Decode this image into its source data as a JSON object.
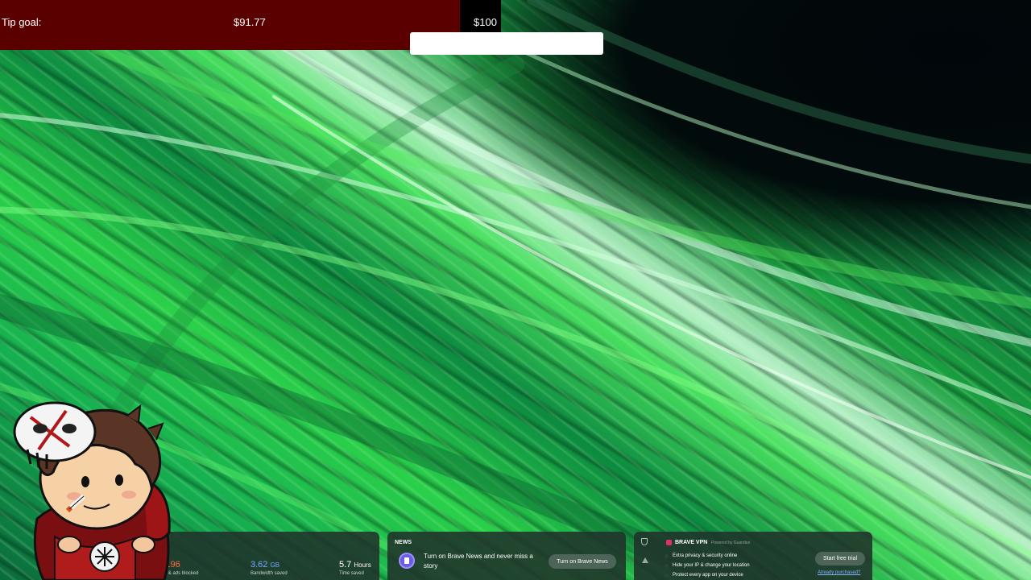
{
  "tip": {
    "label": "Tip goal:",
    "current": "$91.77",
    "goal": "$100",
    "progress_fraction": 0.9177
  },
  "stats": {
    "trackers_value": "406,196",
    "trackers_label": "Trackers & ads blocked",
    "bandwidth_value": "3.62",
    "bandwidth_unit": "GB",
    "bandwidth_label": "Bandwidth saved",
    "time_value": "5.7",
    "time_unit": "Hours",
    "time_label": "Time saved"
  },
  "news": {
    "title": "NEWS",
    "text": "Turn on Brave News and never miss a story",
    "button": "Turn on Brave News"
  },
  "vpn": {
    "title": "BRAVE VPN",
    "powered_by": "Powered by Guardian",
    "features": [
      "Extra privacy & security online",
      "Hide your IP & change your location",
      "Protect every app on your device"
    ],
    "button": "Start free trial",
    "link": "Already purchased?"
  },
  "colors": {
    "tip_fill": "#5b0000",
    "tip_track": "#000000",
    "trackers_accent": "#ff6a3c",
    "bandwidth_accent": "#7aa8ff",
    "news_icon": "#6b5ce0",
    "vpn_logo": "#e0306a"
  },
  "icons": {
    "news": "newspaper-icon",
    "vpn_shield": "shield-icon",
    "vpn_alert": "warning-icon",
    "vpn_logo": "brave-vpn-logo-icon"
  }
}
